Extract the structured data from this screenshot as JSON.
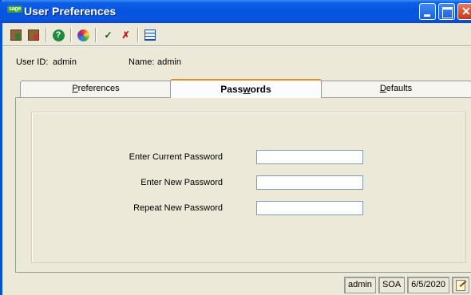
{
  "window": {
    "app_logo": "sage",
    "title": "User Preferences",
    "controls": {
      "minimize": "minimize-icon",
      "maximize": "maximize-icon",
      "close": "close-icon"
    }
  },
  "toolbar": {
    "buttons": [
      "save-icon",
      "delete-icon",
      "help-icon",
      "color-icon",
      "spellcheck-icon",
      "spellcheck-options-icon",
      "grid-icon"
    ]
  },
  "user": {
    "id_label": "User ID:",
    "id_value": "admin",
    "name_label": "Name:",
    "name_value": "admin"
  },
  "tabs": [
    {
      "pre": "",
      "accel": "P",
      "post": "references",
      "selected": false
    },
    {
      "pre": "Pass",
      "accel": "w",
      "post": "ords",
      "selected": true
    },
    {
      "pre": "",
      "accel": "D",
      "post": "efaults",
      "selected": false
    }
  ],
  "form": {
    "current_label": "Enter Current Password",
    "current_value": "",
    "new_label": "Enter New Password",
    "new_value": "",
    "repeat_label": "Repeat New Password",
    "repeat_value": ""
  },
  "status": {
    "user": "admin",
    "company": "SOA",
    "date": "6/5/2020",
    "icon": "notes-icon"
  },
  "colors": {
    "titlebar": "#0454df",
    "window_bg": "#ece9d8",
    "tab_highlight": "#e68b2c"
  }
}
